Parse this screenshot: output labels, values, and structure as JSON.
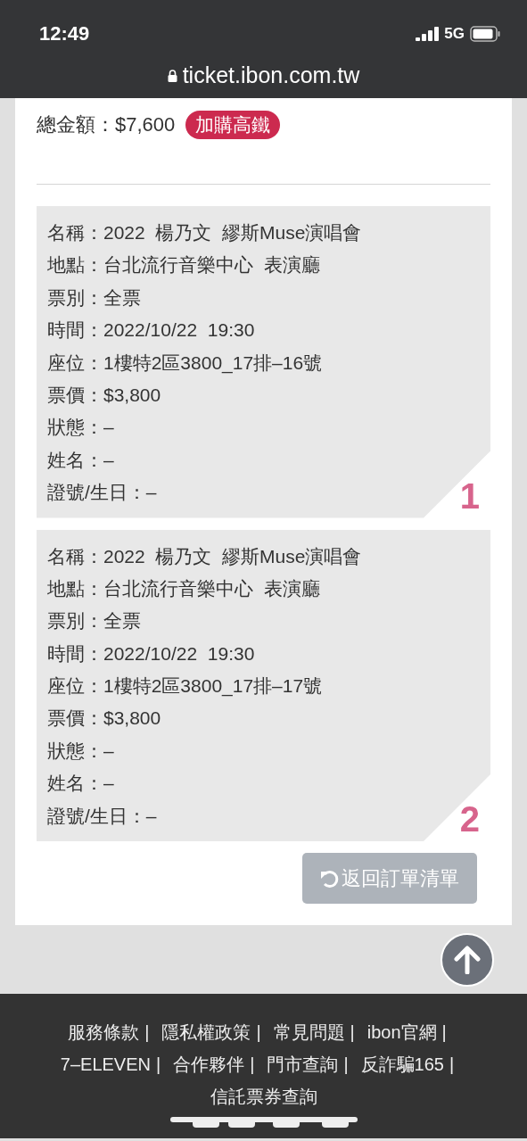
{
  "status_bar": {
    "time": "12:49",
    "network": "5G"
  },
  "browser": {
    "url": "ticket.ibon.com.tw"
  },
  "order": {
    "total": "總金額：$7,600",
    "action": "加購高鐵"
  },
  "tickets": [
    {
      "number": "1",
      "lines": [
        "名稱：2022  楊乃文  繆斯Muse演唱會",
        "地點：台北流行音樂中心  表演廳",
        "票別：全票",
        "時間：2022/10/22  19:30",
        "座位：1樓特2區3800_17排–16號",
        "票價：$3,800",
        "狀態：–",
        "姓名：–",
        "證號/生日：–"
      ]
    },
    {
      "number": "2",
      "lines": [
        "名稱：2022  楊乃文  繆斯Muse演唱會",
        "地點：台北流行音樂中心  表演廳",
        "票別：全票",
        "時間：2022/10/22  19:30",
        "座位：1樓特2區3800_17排–17號",
        "票價：$3,800",
        "狀態：–",
        "姓名：–",
        "證號/生日：–"
      ]
    }
  ],
  "back_button": "返回訂單清單",
  "footer": {
    "separator": "|",
    "links": [
      "服務條款",
      "隱私權政策",
      "常見問題",
      "ibon官網",
      "7–ELEVEN",
      "合作夥伴",
      "門市查詢",
      "反詐騙165",
      "信託票券查詢"
    ]
  }
}
